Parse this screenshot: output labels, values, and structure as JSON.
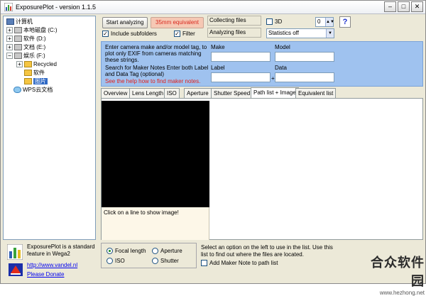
{
  "window": {
    "title": "ExposurePlot - version 1.1.5",
    "minimize": "–",
    "maximize": "□",
    "close": "✕"
  },
  "tree": {
    "items": [
      {
        "label": "计算机",
        "expander": "",
        "icon": "computer-icon"
      },
      {
        "label": "本地磁盘 (C:)",
        "expander": "+",
        "icon": "drive-icon"
      },
      {
        "label": "软件 (D:)",
        "expander": "+",
        "icon": "drive-icon"
      },
      {
        "label": "文档 (E:)",
        "expander": "+",
        "icon": "drive-icon"
      },
      {
        "label": "娱乐 (F:)",
        "expander": "−",
        "icon": "drive-icon"
      },
      {
        "label": "Recycled",
        "expander": "+",
        "icon": "folder-icon"
      },
      {
        "label": "软件",
        "expander": "",
        "icon": "folder-icon"
      },
      {
        "label": "图片",
        "expander": "",
        "icon": "folder-icon"
      },
      {
        "label": "WPS云文档",
        "expander": "",
        "icon": "cloud-icon"
      }
    ]
  },
  "about": {
    "text": "ExposurePlot is a standard feature in Wega2",
    "website": "http://www.vandel.nl",
    "donate": "Please Donate"
  },
  "toolbar": {
    "start_label": "Start analyzing",
    "mm35_label": "35mm equivalent",
    "include_subfolders": "Include subfolders",
    "include_subfolders_checked": "✓",
    "filter": "Filter",
    "filter_checked": "✓",
    "collecting": "Collecting files",
    "analyzing": "Analyzing files",
    "threed": "3D",
    "spin_value": "0",
    "statistics": "Statistics off",
    "help": "?"
  },
  "filter_panel": {
    "text1": "Enter camera make and/or model tag, to plot only EXIF from cameras matching these strings.",
    "text2": "Search for Maker Notes Enter both Label and Data Tag (optional)",
    "help_link": "See the help how to find maker notes.",
    "make_label": "Make",
    "model_label": "Model",
    "label_label": "Label",
    "data_label": "Data",
    "plus": "+"
  },
  "tabs": [
    {
      "label": "Overview"
    },
    {
      "label": "Lens Length"
    },
    {
      "label": "ISO"
    },
    {
      "label": "Aperture"
    },
    {
      "label": "Shutter Speed"
    },
    {
      "label": "Path list + Image"
    },
    {
      "label": "Equivalent list"
    }
  ],
  "preview": {
    "caption": "Click on a line to show image!"
  },
  "options": {
    "focal_length": "Focal length",
    "aperture": "Aperture",
    "iso": "ISO",
    "shutter": "Shutter",
    "note": "Select an option on the left to use in the list. Use this list to find out where the files are located.",
    "maker_note": "Add Maker Note to path list"
  },
  "watermark": {
    "big": "合众软件园",
    "small": "www.hezhong.net"
  },
  "colors": {
    "panel_blue": "#9fc2ef",
    "accent_red": "#e3201a",
    "selection": "#316ac5"
  }
}
